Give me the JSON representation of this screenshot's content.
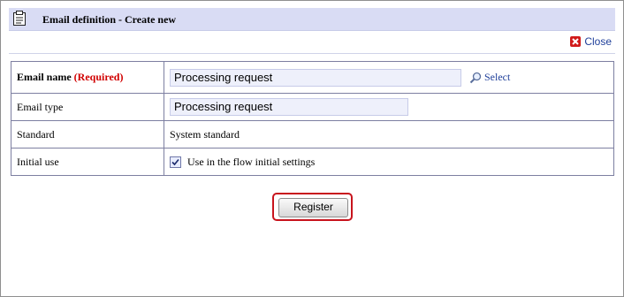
{
  "window": {
    "title": "Email definition - Create new"
  },
  "toolbar": {
    "close_label": "Close"
  },
  "form": {
    "email_name": {
      "label": "Email name",
      "required_label": "(Required)",
      "value": "Processing request",
      "select_label": "Select"
    },
    "email_type": {
      "label": "Email type",
      "value": "Processing request"
    },
    "standard": {
      "label": "Standard",
      "value": "System standard"
    },
    "initial_use": {
      "label": "Initial use",
      "checkbox_label": "Use in the flow initial settings",
      "checked": true
    }
  },
  "actions": {
    "register_label": "Register"
  },
  "colors": {
    "title_bar": "#d9dcf4",
    "border": "#7d7fa1",
    "link": "#1f3f9a",
    "required": "#d10000",
    "highlight": "#c8141d"
  },
  "icons": [
    "clipboard-icon",
    "close-icon",
    "search-icon",
    "checkmark-icon"
  ]
}
